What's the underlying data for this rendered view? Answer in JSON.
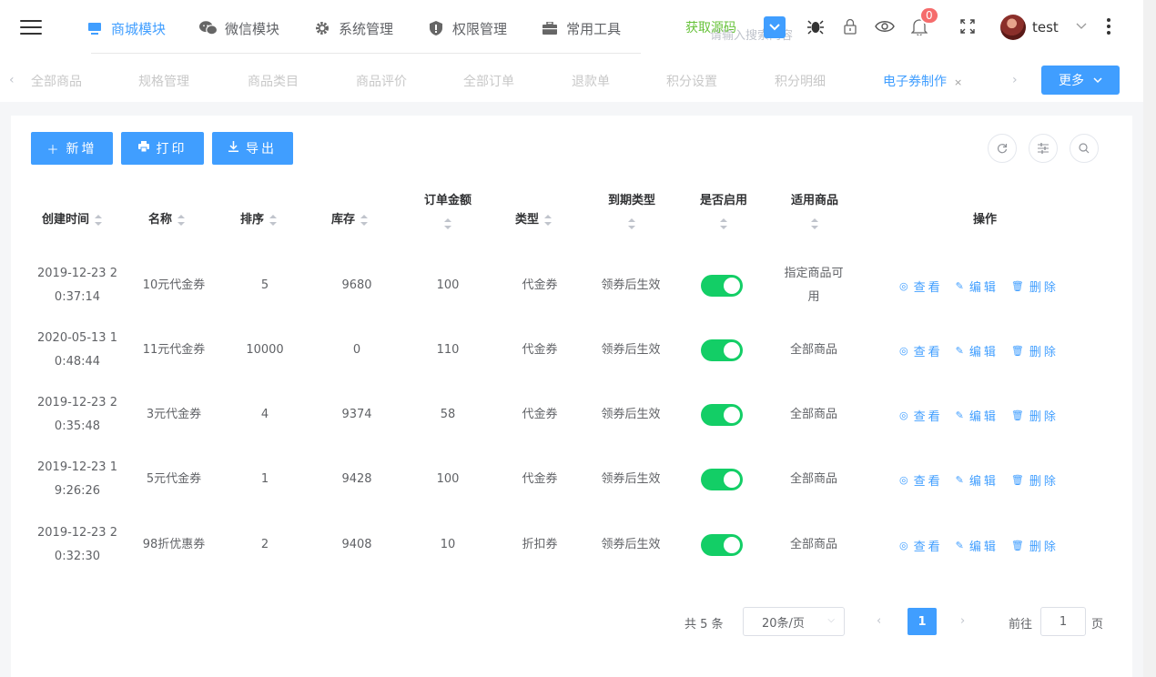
{
  "nav": {
    "items": [
      {
        "label": "商城模块"
      },
      {
        "label": "微信模块"
      },
      {
        "label": "系统管理"
      },
      {
        "label": "权限管理"
      },
      {
        "label": "常用工具"
      }
    ],
    "source_link": "获取源码",
    "search_placeholder": "请输入搜索内容",
    "notification_count": "0",
    "username": "test"
  },
  "tags": {
    "items": [
      {
        "label": "全部商品"
      },
      {
        "label": "规格管理"
      },
      {
        "label": "商品类目"
      },
      {
        "label": "商品评价"
      },
      {
        "label": "全部订单"
      },
      {
        "label": "退款单"
      },
      {
        "label": "积分设置"
      },
      {
        "label": "积分明细"
      },
      {
        "label": "电子券制作"
      }
    ],
    "close_symbol": "×",
    "more_label": "更多"
  },
  "toolbar": {
    "add_label": "新增",
    "print_label": "打印",
    "export_label": "导出"
  },
  "table": {
    "headers": {
      "created": "创建时间",
      "name": "名称",
      "sort": "排序",
      "stock": "库存",
      "order_amount": "订单金额",
      "type": "类型",
      "expire_type": "到期类型",
      "enabled": "是否启用",
      "applicable": "适用商品",
      "actions": "操作"
    },
    "rows": [
      {
        "created_1": "2019-12-23 2",
        "created_2": "0:37:14",
        "name": "10元代金券",
        "sort": "5",
        "stock": "9680",
        "amount": "100",
        "type": "代金券",
        "expire": "领券后生效",
        "enabled": true,
        "applicable_1": "指定商品可",
        "applicable_2": "用"
      },
      {
        "created_1": "2020-05-13 1",
        "created_2": "0:48:44",
        "name": "11元代金券",
        "sort": "10000",
        "stock": "0",
        "amount": "110",
        "type": "代金券",
        "expire": "领券后生效",
        "enabled": true,
        "applicable_1": "全部商品",
        "applicable_2": ""
      },
      {
        "created_1": "2019-12-23 2",
        "created_2": "0:35:48",
        "name": "3元代金券",
        "sort": "4",
        "stock": "9374",
        "amount": "58",
        "type": "代金券",
        "expire": "领券后生效",
        "enabled": true,
        "applicable_1": "全部商品",
        "applicable_2": ""
      },
      {
        "created_1": "2019-12-23 1",
        "created_2": "9:26:26",
        "name": "5元代金券",
        "sort": "1",
        "stock": "9428",
        "amount": "100",
        "type": "代金券",
        "expire": "领券后生效",
        "enabled": true,
        "applicable_1": "全部商品",
        "applicable_2": ""
      },
      {
        "created_1": "2019-12-23 2",
        "created_2": "0:32:30",
        "name": "98折优惠券",
        "sort": "2",
        "stock": "9408",
        "amount": "10",
        "type": "折扣券",
        "expire": "领券后生效",
        "enabled": true,
        "applicable_1": "全部商品",
        "applicable_2": ""
      }
    ],
    "actions": {
      "view": "查看",
      "edit": "编辑",
      "delete": "删除"
    }
  },
  "pagination": {
    "total": "共 5 条",
    "page_size": "20条/页",
    "current_page": "1",
    "goto_label": "前往",
    "goto_value": "1",
    "page_suffix": "页"
  },
  "colors": {
    "primary": "#409eff",
    "success_switch": "#13ce66",
    "source_link": "#67c23a",
    "badge": "#f56c6c"
  }
}
